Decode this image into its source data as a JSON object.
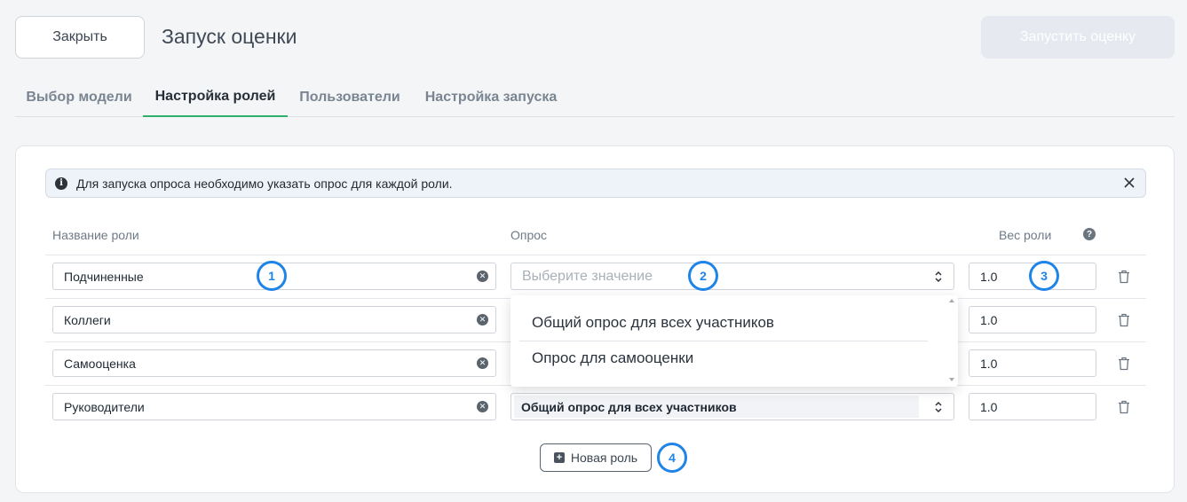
{
  "header": {
    "close_label": "Закрыть",
    "title": "Запуск оценки",
    "launch_label": "Запустить оценку"
  },
  "tabs": [
    {
      "label": "Выбор модели",
      "active": false
    },
    {
      "label": "Настройка ролей",
      "active": true
    },
    {
      "label": "Пользователи",
      "active": false
    },
    {
      "label": "Настройка запуска",
      "active": false
    }
  ],
  "info": {
    "text": "Для запуска опроса необходимо указать опрос для каждой роли.",
    "icon": "info-icon"
  },
  "columns": {
    "role": "Название роли",
    "survey": "Опрос",
    "weight": "Вес роли"
  },
  "survey_placeholder": "Выберите значение",
  "rows": [
    {
      "role": "Подчиненные",
      "survey": "",
      "weight": "1.0"
    },
    {
      "role": "Коллеги",
      "survey": "",
      "weight": "1.0"
    },
    {
      "role": "Самооценка",
      "survey": "",
      "weight": "1.0"
    },
    {
      "role": "Руководители",
      "survey": "Общий опрос для всех участников",
      "weight": "1.0"
    }
  ],
  "dropdown_options": [
    "Общий опрос для всех участников",
    "Опрос для самооценки"
  ],
  "new_role_label": "Новая роль",
  "badges": [
    "1",
    "2",
    "3",
    "4"
  ],
  "colors": {
    "accent": "#1f84e8",
    "tab_active": "#2eb06a",
    "launch_disabled": "#e6e9f0"
  }
}
